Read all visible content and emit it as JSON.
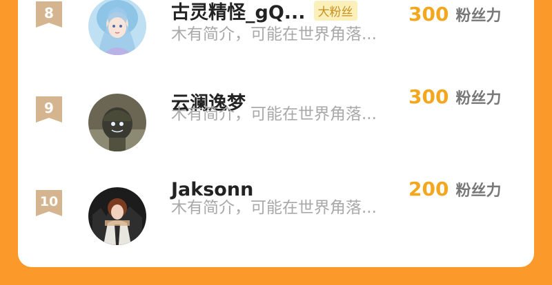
{
  "rows": [
    {
      "rank": "8",
      "name": "古灵精怪_gQ...",
      "badge": "大粉丝",
      "bio": "木有简介，可能在世界角落...",
      "score": "300",
      "unit": "粉丝力"
    },
    {
      "rank": "9",
      "name": "云澜逸梦",
      "badge": "",
      "bio": "木有简介，可能在世界角落...",
      "score": "300",
      "unit": "粉丝力"
    },
    {
      "rank": "10",
      "name": "Jaksonn",
      "badge": "",
      "bio": "木有简介，可能在世界角落...",
      "score": "200",
      "unit": "粉丝力"
    }
  ],
  "colors": {
    "background": "#fb9a2a",
    "rank_badge": "#d5b58f",
    "score": "#f2a71e",
    "fan_badge_bg": "#fbf0b9",
    "fan_badge_text": "#c69023"
  }
}
